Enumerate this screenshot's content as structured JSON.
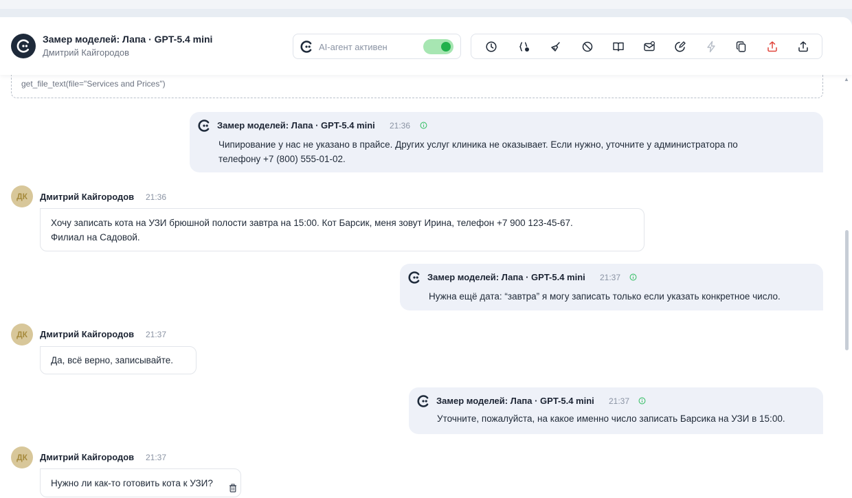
{
  "header": {
    "title": "Замер моделей: Лапа · GPT-5.4 mini",
    "subtitle": "Дмитрий Кайгородов",
    "agent_label": "AI-агент активен",
    "agent_enabled": true,
    "toolbar_icons": [
      "clock-icon",
      "variables-icon",
      "broom-icon",
      "block-icon",
      "book-icon",
      "mail-icon",
      "edit-icon",
      "bolt-icon",
      "copy-icon",
      "export-red-icon",
      "upload-icon"
    ]
  },
  "colors": {
    "accent_green": "#22b14c",
    "bot_bubble": "#eef1f8",
    "export_red": "#e0443a"
  },
  "tool_call": {
    "text": "get_file_text(file=\"Services and Prices\")"
  },
  "messages": [
    {
      "type": "bot",
      "name": "Замер моделей: Лапа · GPT-5.4 mini",
      "time": "21:36",
      "lines": [
        "Чипирование у нас не указано в прайсе. Других услуг клиника не оказывает. Если нужно, уточните у администратора по",
        "телефону +7 (800) 555-01-02."
      ]
    },
    {
      "type": "user",
      "initials": "ДК",
      "name": "Дмитрий Кайгородов",
      "time": "21:36",
      "lines": [
        "Хочу записать кота на УЗИ брюшной полости завтра на 15:00. Кот Барсик, меня зовут Ирина, телефон +7 900 123-45-67.",
        "Филиал на Садовой."
      ]
    },
    {
      "type": "bot",
      "name": "Замер моделей: Лапа · GPT-5.4 mini",
      "time": "21:37",
      "lines": [
        "Нужна ещё дата: “завтра” я могу записать только если указать конкретное число."
      ]
    },
    {
      "type": "user",
      "initials": "ДК",
      "name": "Дмитрий Кайгородов",
      "time": "21:37",
      "lines": [
        "Да, всё верно, записывайте."
      ]
    },
    {
      "type": "bot",
      "name": "Замер моделей: Лапа · GPT-5.4 mini",
      "time": "21:37",
      "lines": [
        "Уточните, пожалуйста, на какое именно число записать Барсика на УЗИ в 15:00."
      ]
    },
    {
      "type": "user",
      "initials": "ДК",
      "name": "Дмитрий Кайгородов",
      "time": "21:37",
      "lines": [
        "Нужно ли как-то готовить кота к УЗИ?"
      ]
    }
  ]
}
